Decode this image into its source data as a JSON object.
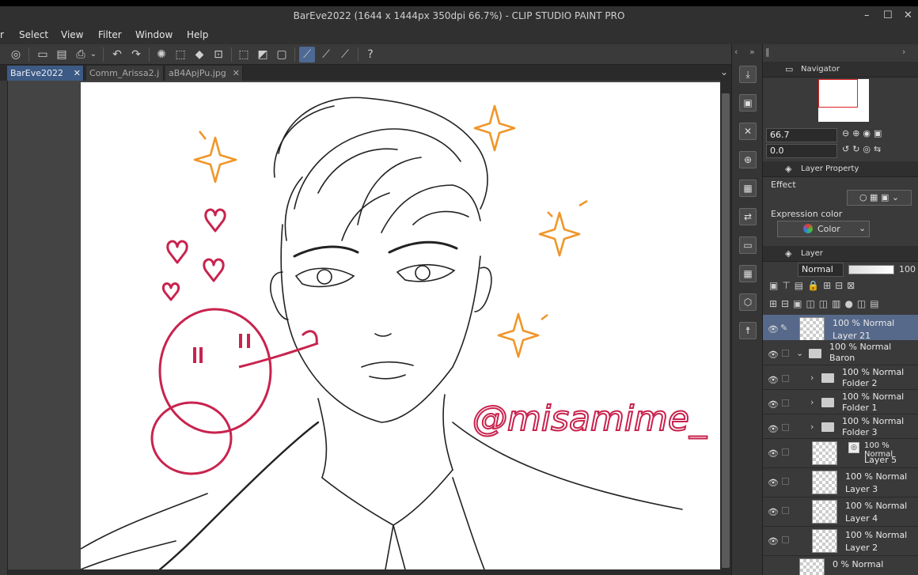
{
  "window": {
    "title": "BarEve2022 (1644 x 1444px 350dpi 66.7%)  - CLIP STUDIO PAINT PRO",
    "minimize": "–",
    "maximize": "☐",
    "close": "✕"
  },
  "menu": {
    "partial": "r",
    "select": "Select",
    "view": "View",
    "filter": "Filter",
    "window": "Window",
    "help": "Help"
  },
  "tabs": [
    {
      "label": "BarEve2022",
      "close": "✕"
    },
    {
      "label": "Comm_Arissa2.j",
      "close": ""
    },
    {
      "label": "aB4ApjPu.jpg",
      "close": "✕"
    }
  ],
  "tab_overflow": "⌄",
  "navigator": {
    "title": "Navigator",
    "zoom_value": "66.7",
    "rotation_value": "0.0"
  },
  "layer_property": {
    "title": "Layer Property",
    "effect_label": "Effect",
    "expression_label": "Expression color",
    "expression_value": "Color"
  },
  "layer_panel": {
    "title": "Layer",
    "blend_mode": "Normal",
    "opacity": "100"
  },
  "layers": [
    {
      "top": "100 % Normal",
      "name": "Layer 21"
    },
    {
      "top": "100 % Normal",
      "name": "Baron"
    },
    {
      "top": "100 % Normal",
      "name": "Folder 2"
    },
    {
      "top": "100 % Normal",
      "name": "Folder 1"
    },
    {
      "top": "100 % Normal",
      "name": "Folder 3"
    },
    {
      "top": "100 % Normal",
      "name": "Layer 5"
    },
    {
      "top": "100 % Normal",
      "name": "Layer 3"
    },
    {
      "top": "100 % Normal",
      "name": "Layer 4"
    },
    {
      "top": "100 % Normal",
      "name": "Layer 2"
    },
    {
      "top": "0 % Normal",
      "name": ""
    }
  ],
  "artwork": {
    "watermark": "@misamime_"
  },
  "colors": {
    "accent_pink": "#c8234e",
    "accent_orange": "#f0962a",
    "selection_blue": "#57698a",
    "tab_active": "#3d5a84"
  }
}
